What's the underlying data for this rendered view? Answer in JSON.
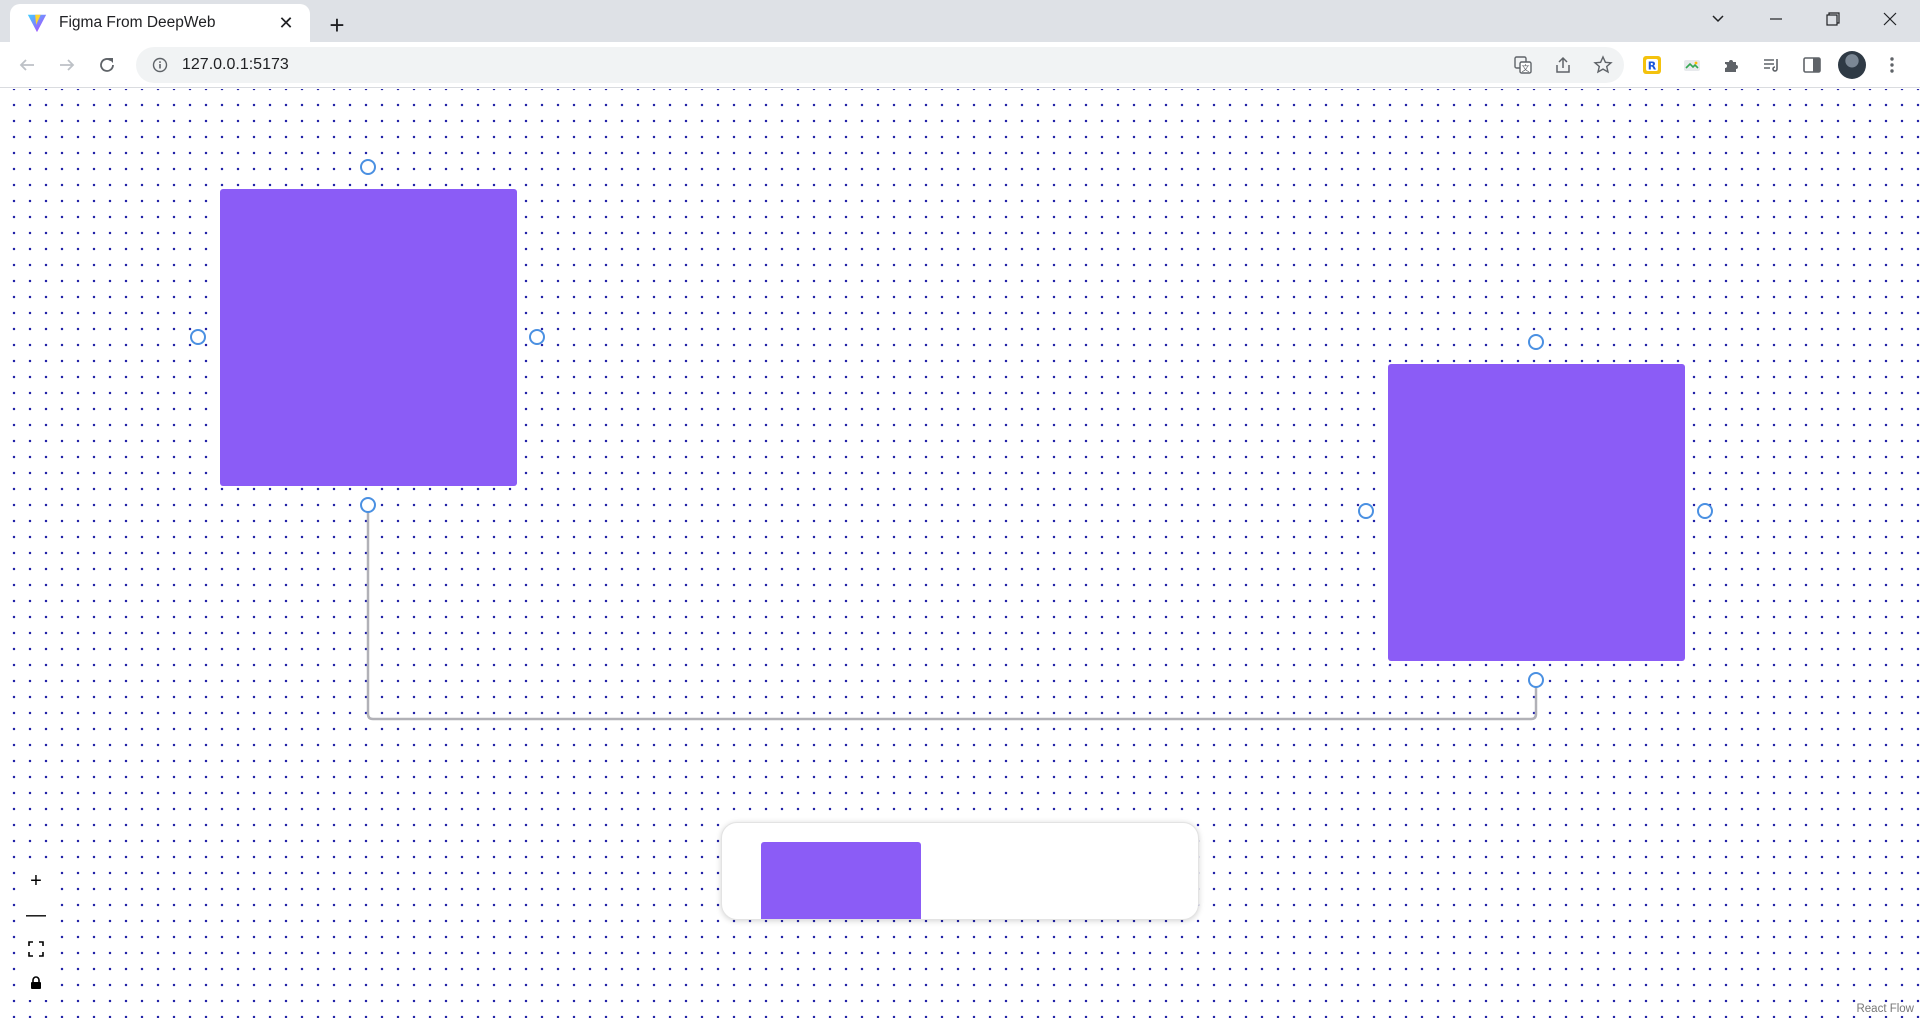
{
  "browser": {
    "tab": {
      "title": "Figma From DeepWeb",
      "favicon": "vite-logo-icon",
      "close_symbol": "✕"
    },
    "new_tab_symbol": "+",
    "window_controls": [
      "tab-search",
      "minimize",
      "restore",
      "close"
    ],
    "address_bar": {
      "url": "127.0.0.1:5173"
    },
    "extensions": [
      "translate-icon",
      "share-icon",
      "bookmark-star-icon",
      "r-extension-icon",
      "image-extension-icon",
      "puzzle-extensions-icon",
      "reading-list-icon",
      "side-panel-icon",
      "profile-avatar",
      "kebab-menu-icon"
    ]
  },
  "canvas": {
    "background": "dotted-grid",
    "dot_color": "#2424a8",
    "nodes": [
      {
        "id": "node-1",
        "color": "#8b5cf6"
      },
      {
        "id": "node-2",
        "color": "#8b5cf6"
      }
    ],
    "edges": [
      {
        "source": "node-1",
        "source_handle": "bottom",
        "target": "node-2",
        "target_handle": "bottom",
        "type": "step",
        "color": "#b1b1b7"
      }
    ],
    "handle_color": "#4a90e2",
    "controls": {
      "zoom_in": "+",
      "zoom_out": "—",
      "fit_view": "fit",
      "lock": "lock"
    },
    "minimap": {
      "node_color": "#8b5cf6"
    },
    "attribution": "React Flow"
  }
}
